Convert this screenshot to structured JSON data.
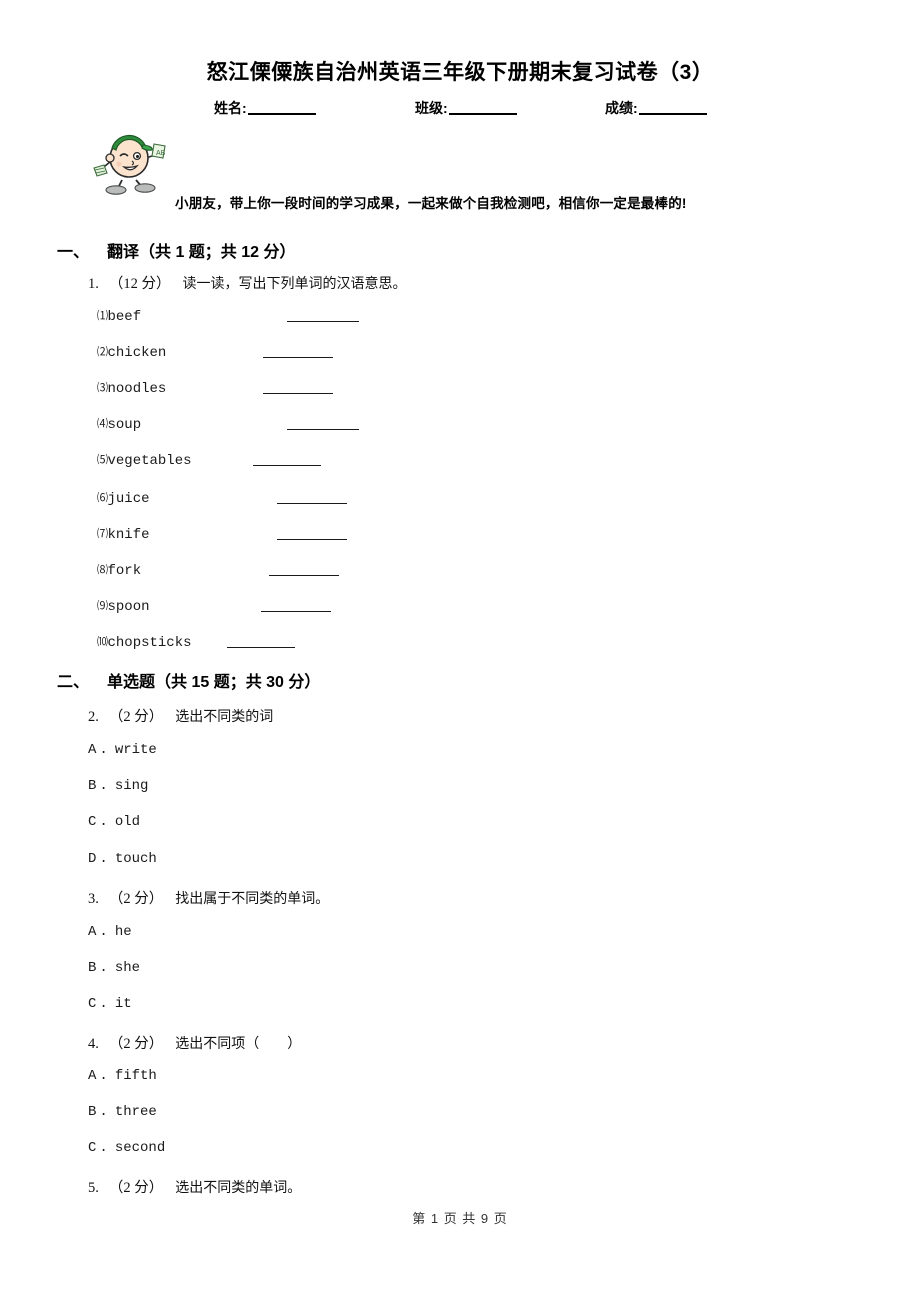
{
  "document": {
    "title": "怒江傈僳族自治州英语三年级下册期末复习试卷（3）",
    "intro": "小朋友，带上你一段时间的学习成果，一起来做个自我检测吧，相信你一定是最棒的!",
    "mascot_icon": "cartoon-student-icon"
  },
  "id_fields": {
    "name_label": "姓名:",
    "class_label": "班级:",
    "score_label": "成绩:"
  },
  "sections": [
    {
      "number": "一、",
      "title": "翻译（共 1 题；共 12 分）"
    },
    {
      "number": "二、",
      "title": "单选题（共 15 题；共 30 分）"
    }
  ],
  "q1": {
    "number": "1.",
    "points": "（12 分）",
    "text": "读一读，写出下列单词的汉语意思。",
    "items": [
      {
        "index": "⑴",
        "word": "beef"
      },
      {
        "index": "⑵",
        "word": "chicken"
      },
      {
        "index": "⑶",
        "word": "noodles"
      },
      {
        "index": "⑷",
        "word": "soup"
      },
      {
        "index": "⑸",
        "word": "vegetables"
      },
      {
        "index": "⑹",
        "word": "juice"
      },
      {
        "index": "⑺",
        "word": "knife"
      },
      {
        "index": "⑻",
        "word": "fork"
      },
      {
        "index": "⑼",
        "word": "spoon"
      },
      {
        "index": "⑽",
        "word": "chopsticks"
      }
    ]
  },
  "q2": {
    "number": "2.",
    "points": "（2 分）",
    "text": "选出不同类的词",
    "options": [
      {
        "letter": "A",
        "dot": ".",
        "value": "write"
      },
      {
        "letter": "B",
        "dot": ".",
        "value": "sing"
      },
      {
        "letter": "C",
        "dot": ".",
        "value": "old"
      },
      {
        "letter": "D",
        "dot": ".",
        "value": "touch"
      }
    ]
  },
  "q3": {
    "number": "3.",
    "points": "（2 分）",
    "text": "找出属于不同类的单词。",
    "options": [
      {
        "letter": "A",
        "dot": ".",
        "value": "he"
      },
      {
        "letter": "B",
        "dot": ".",
        "value": "she"
      },
      {
        "letter": "C",
        "dot": ".",
        "value": "it"
      }
    ]
  },
  "q4": {
    "number": "4.",
    "points": "（2 分）",
    "text": "选出不同项（　　）",
    "options": [
      {
        "letter": "A",
        "dot": ".",
        "value": "fifth"
      },
      {
        "letter": "B",
        "dot": ".",
        "value": "three"
      },
      {
        "letter": "C",
        "dot": ".",
        "value": "second"
      }
    ]
  },
  "q5": {
    "number": "5.",
    "points": "（2 分）",
    "text": "选出不同类的单词。"
  },
  "footer": {
    "text": "第 1 页 共 9 页"
  }
}
